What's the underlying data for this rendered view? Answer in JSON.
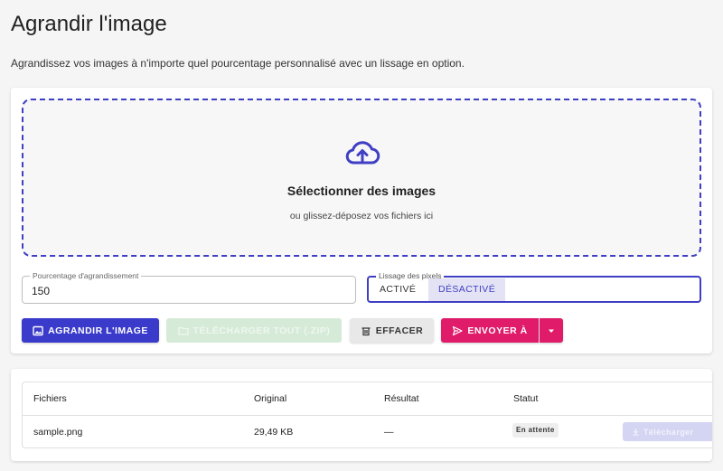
{
  "page": {
    "title": "Agrandir l'image",
    "description": "Agrandissez vos images à n'importe quel pourcentage personnalisé avec un lissage en option."
  },
  "dropzone": {
    "icon": "cloud-upload-icon",
    "title": "Sélectionner des images",
    "subtitle": "ou glissez-déposez vos fichiers ici"
  },
  "form": {
    "percent_label": "Pourcentage d'agrandissement",
    "percent_value": "150",
    "smoothing_label": "Lissage des pixels",
    "smoothing_on": "Activé",
    "smoothing_off": "Désactivé",
    "smoothing_selected": "Désactivé"
  },
  "toolbar": {
    "enlarge_label": "Agrandir l'image",
    "download_all_label": "Télécharger tout (.zip)",
    "clear_label": "Effacer",
    "send_label": "Envoyer à"
  },
  "table": {
    "headers": [
      "Fichiers",
      "Original",
      "Résultat",
      "Statut"
    ],
    "rows": [
      {
        "file": "sample.png",
        "original": "29,49 KB",
        "result": "—",
        "status": "En attente",
        "action": "Télécharger"
      }
    ]
  },
  "colors": {
    "primary": "#3a3acb",
    "accent": "#df1b6a",
    "success_disabled": "#d6ead8"
  }
}
